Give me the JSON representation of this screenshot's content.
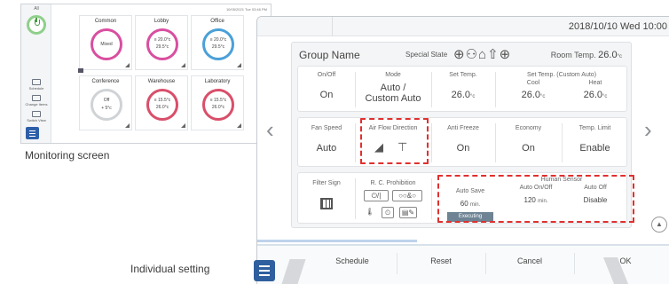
{
  "monitoring": {
    "caption": "Monitoring screen",
    "all_label": "All",
    "datetime": "10/05/2021 Tue 03:46 PM",
    "nav": [
      "Schedule",
      "Change Items",
      "Switch View"
    ],
    "tiles": [
      {
        "name": "Common",
        "lines": [
          "Mixed"
        ],
        "ring_color": "#d94fa0"
      },
      {
        "name": "Lobby",
        "lines": [
          "≡ 20.0°c",
          "29.5°c"
        ],
        "ring_color": "#d94fa0"
      },
      {
        "name": "Office",
        "lines": [
          "≡ 20.0°c",
          "29.5°c"
        ],
        "ring_color": "#4aa0d8"
      },
      {
        "name": "Conference",
        "lines": [
          "Off",
          "+ 5°c"
        ],
        "ring_color": "#cfd3d6"
      },
      {
        "name": "Warehouse",
        "lines": [
          "≡ 15.5°c",
          "26.0°c"
        ],
        "ring_color": "#d94f6a"
      },
      {
        "name": "Laboratory",
        "lines": [
          "≡ 15.5°c",
          "26.0°c"
        ],
        "ring_color": "#d94f6a"
      }
    ]
  },
  "individual": {
    "caption": "Individual setting",
    "datetime": "2018/10/10 Wed 10:00",
    "group_name": "Group Name",
    "special_state_label": "Special State",
    "special_state_icons": "⊕⚇⌂⇧⊕",
    "room_temp_label": "Room Temp.",
    "room_temp_value": "26.0",
    "room_temp_unit": "°c",
    "row1": {
      "onoff_label": "On/Off",
      "onoff_value": "On",
      "mode_label": "Mode",
      "mode_value1": "Auto /",
      "mode_value2": "Custom Auto",
      "settemp_label": "Set Temp.",
      "settemp_value": "26.0",
      "unit": "°c",
      "custom_label": "Set Temp. (Custom Auto)",
      "cool_label": "Cool",
      "cool_value": "26.0",
      "heat_label": "Heat",
      "heat_value": "26.0"
    },
    "row2": {
      "fan_label": "Fan Speed",
      "fan_value": "Auto",
      "airflow_label": "Air Flow Direction",
      "antifreeze_label": "Anti Freeze",
      "antifreeze_value": "On",
      "economy_label": "Economy",
      "economy_value": "On",
      "templimit_label": "Temp. Limit",
      "templimit_value": "Enable"
    },
    "row3": {
      "filter_label": "Filter Sign",
      "prohibition_label": "R. C. Prohibition",
      "prohibition_icons": [
        "⏻/|",
        "○○&○",
        "🌡",
        "⏲",
        "▤✎"
      ],
      "autosave_label": "Auto Save",
      "autosave_value": "60",
      "autosave_unit": "min.",
      "executing": "Executing",
      "human_label": "Human Sensor",
      "auto_onoff_label": "Auto On/Off",
      "auto_onoff_value": "120",
      "auto_onoff_unit": "min.",
      "auto_off_label": "Auto Off",
      "auto_off_value": "Disable"
    },
    "bottom": [
      "Schedule",
      "Reset",
      "Cancel",
      "OK"
    ]
  },
  "colors": {
    "highlight": "#e0302f",
    "menu": "#2f5f9e"
  }
}
